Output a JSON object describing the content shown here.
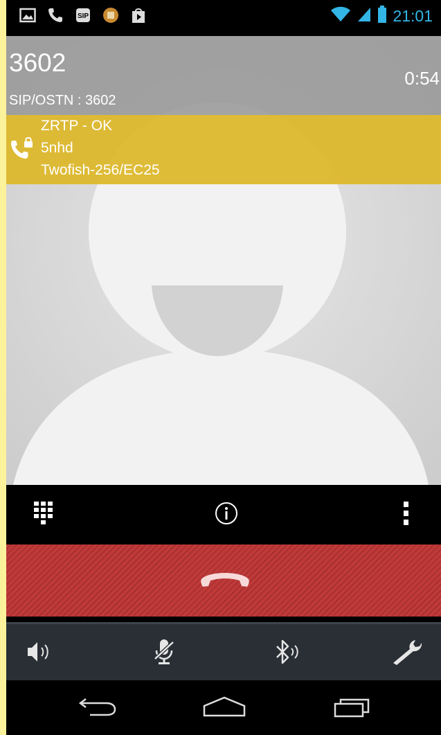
{
  "status_bar": {
    "time": "21:01",
    "left_icons": [
      "picture-icon",
      "phone-icon",
      "sip-app-icon",
      "app-icon",
      "play-store-icon"
    ],
    "right_icons": [
      "wifi-icon",
      "signal-icon",
      "battery-icon"
    ],
    "accent_color": "#33b5e5"
  },
  "call": {
    "number": "3602",
    "duration": "0:54",
    "sip_line": "SIP/OSTN : 3602"
  },
  "zrtp": {
    "status": "ZRTP - OK",
    "sas": "5nhd",
    "cipher": "Twofish-256/EC25",
    "banner_color": "#ddb82c"
  },
  "action_bar": {
    "buttons": [
      "dialpad-icon",
      "info-icon",
      "overflow-menu-icon"
    ]
  },
  "end_call": {
    "icon": "hangup-icon",
    "color": "#c03a3a"
  },
  "toolbar": {
    "buttons": [
      "speaker-icon",
      "mute-mic-icon",
      "bluetooth-icon",
      "settings-wrench-icon"
    ]
  },
  "nav_bar": {
    "buttons": [
      "back-icon",
      "home-icon",
      "recent-apps-icon"
    ]
  }
}
